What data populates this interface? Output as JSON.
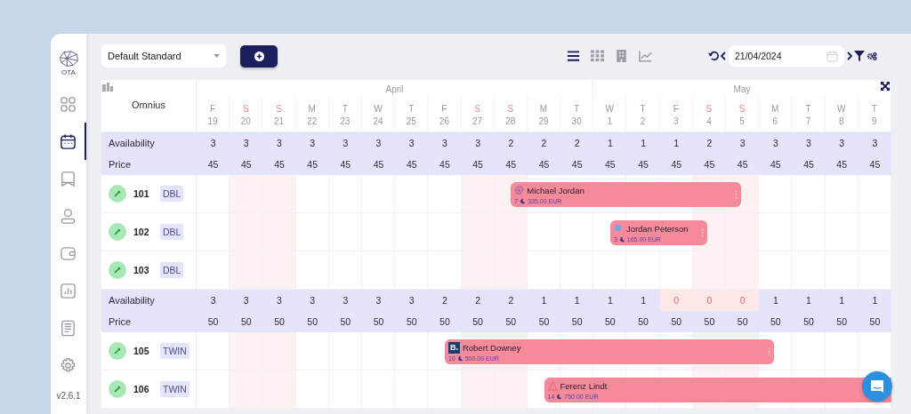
{
  "sidebar": {
    "logo_text": "OTA",
    "items": [
      {
        "kind": "dashboard",
        "selected": false
      },
      {
        "kind": "calendar",
        "selected": true
      },
      {
        "kind": "bookmark",
        "selected": false
      },
      {
        "kind": "user",
        "selected": false
      },
      {
        "kind": "wallet",
        "selected": false
      },
      {
        "kind": "chart",
        "selected": false
      },
      {
        "kind": "document",
        "selected": false
      },
      {
        "kind": "settings",
        "selected": false
      }
    ],
    "version": "v2.6.1"
  },
  "toolbar": {
    "rate_plan": "Default Standard",
    "views": [
      {
        "kind": "list",
        "selected": true
      },
      {
        "kind": "grid",
        "selected": false
      },
      {
        "kind": "building",
        "selected": false
      },
      {
        "kind": "chart",
        "selected": false
      }
    ],
    "date": "21/04/2024"
  },
  "calendar": {
    "property": "Omnius",
    "months": [
      {
        "label": "April",
        "days": [
          {
            "weekday": "F",
            "date": "19",
            "weekend": false
          },
          {
            "weekday": "S",
            "date": "20",
            "weekend": true
          },
          {
            "weekday": "S",
            "date": "21",
            "weekend": true
          },
          {
            "weekday": "M",
            "date": "22",
            "weekend": false
          },
          {
            "weekday": "T",
            "date": "23",
            "weekend": false
          },
          {
            "weekday": "W",
            "date": "24",
            "weekend": false
          },
          {
            "weekday": "T",
            "date": "25",
            "weekend": false
          },
          {
            "weekday": "F",
            "date": "26",
            "weekend": false
          },
          {
            "weekday": "S",
            "date": "27",
            "weekend": true
          },
          {
            "weekday": "S",
            "date": "28",
            "weekend": true
          },
          {
            "weekday": "M",
            "date": "29",
            "weekend": false
          },
          {
            "weekday": "T",
            "date": "30",
            "weekend": false
          }
        ]
      },
      {
        "label": "May",
        "days": [
          {
            "weekday": "W",
            "date": "1",
            "weekend": false
          },
          {
            "weekday": "T",
            "date": "2",
            "weekend": false
          },
          {
            "weekday": "F",
            "date": "3",
            "weekend": false
          },
          {
            "weekday": "S",
            "date": "4",
            "weekend": true
          },
          {
            "weekday": "S",
            "date": "5",
            "weekend": true
          },
          {
            "weekday": "M",
            "date": "6",
            "weekend": false
          },
          {
            "weekday": "T",
            "date": "7",
            "weekend": false
          },
          {
            "weekday": "W",
            "date": "8",
            "weekend": false
          },
          {
            "weekday": "T",
            "date": "9",
            "weekend": false
          }
        ]
      }
    ],
    "groups": [
      {
        "availability_label": "Availability",
        "price_label": "Price",
        "availability": [
          {
            "value": "3",
            "sold_out": false
          },
          {
            "value": "3",
            "sold_out": false
          },
          {
            "value": "3",
            "sold_out": false
          },
          {
            "value": "3",
            "sold_out": false
          },
          {
            "value": "3",
            "sold_out": false
          },
          {
            "value": "3",
            "sold_out": false
          },
          {
            "value": "3",
            "sold_out": false
          },
          {
            "value": "3",
            "sold_out": false
          },
          {
            "value": "3",
            "sold_out": false
          },
          {
            "value": "2",
            "sold_out": false
          },
          {
            "value": "2",
            "sold_out": false
          },
          {
            "value": "2",
            "sold_out": false
          },
          {
            "value": "1",
            "sold_out": false
          },
          {
            "value": "1",
            "sold_out": false
          },
          {
            "value": "1",
            "sold_out": false
          },
          {
            "value": "2",
            "sold_out": false
          },
          {
            "value": "3",
            "sold_out": false
          },
          {
            "value": "3",
            "sold_out": false
          },
          {
            "value": "3",
            "sold_out": false
          },
          {
            "value": "3",
            "sold_out": false
          },
          {
            "value": "3",
            "sold_out": false
          }
        ],
        "price": [
          "45",
          "45",
          "45",
          "45",
          "45",
          "45",
          "45",
          "45",
          "45",
          "45",
          "45",
          "45",
          "45",
          "45",
          "45",
          "45",
          "45",
          "45",
          "45",
          "45",
          "45"
        ],
        "rooms": [
          {
            "number": "101",
            "type": "DBL",
            "clean": true,
            "slots": [
              {
                "kind": "free"
              },
              {
                "kind": "free"
              },
              {
                "kind": "free"
              },
              {
                "kind": "free"
              },
              {
                "kind": "free"
              },
              {
                "kind": "free"
              },
              {
                "kind": "free"
              },
              {
                "kind": "free"
              },
              {
                "kind": "free"
              },
              {
                "kind": "booking",
                "guest": "Michael Jordan",
                "nights": "7",
                "amount": "335.00 EUR",
                "source": {
                  "kind": "mesh"
                }
              }
            ]
          },
          {
            "number": "102",
            "type": "DBL",
            "clean": true,
            "slots": [
              {
                "kind": "free"
              },
              {
                "kind": "free"
              },
              {
                "kind": "free"
              },
              {
                "kind": "free"
              },
              {
                "kind": "free"
              },
              {
                "kind": "free"
              },
              {
                "kind": "free"
              },
              {
                "kind": "free"
              },
              {
                "kind": "free"
              },
              {
                "kind": "free"
              },
              {
                "kind": "free"
              },
              {
                "kind": "free"
              },
              {
                "kind": "booking",
                "guest": "Jordan Peterson",
                "nights": "3",
                "amount": "165.00 EUR",
                "source": {
                  "kind": "dot"
                }
              }
            ]
          },
          {
            "number": "103",
            "type": "DBL",
            "clean": true
          }
        ]
      },
      {
        "availability_label": "Availability",
        "price_label": "Price",
        "availability": [
          {
            "value": "3",
            "sold_out": false
          },
          {
            "value": "3",
            "sold_out": false
          },
          {
            "value": "3",
            "sold_out": false
          },
          {
            "value": "3",
            "sold_out": false
          },
          {
            "value": "3",
            "sold_out": false
          },
          {
            "value": "3",
            "sold_out": false
          },
          {
            "value": "3",
            "sold_out": false
          },
          {
            "value": "2",
            "sold_out": false
          },
          {
            "value": "2",
            "sold_out": false
          },
          {
            "value": "2",
            "sold_out": false
          },
          {
            "value": "1",
            "sold_out": false
          },
          {
            "value": "1",
            "sold_out": false
          },
          {
            "value": "1",
            "sold_out": false
          },
          {
            "value": "1",
            "sold_out": false
          },
          {
            "value": "0",
            "sold_out": true
          },
          {
            "value": "0",
            "sold_out": true
          },
          {
            "value": "0",
            "sold_out": true
          },
          {
            "value": "1",
            "sold_out": false
          },
          {
            "value": "1",
            "sold_out": false
          },
          {
            "value": "1",
            "sold_out": false
          },
          {
            "value": "1",
            "sold_out": false
          }
        ],
        "price": [
          "50",
          "50",
          "50",
          "50",
          "50",
          "50",
          "50",
          "50",
          "50",
          "50",
          "50",
          "50",
          "50",
          "50",
          "50",
          "50",
          "50",
          "50",
          "50",
          "50",
          "50"
        ],
        "rooms": [
          {
            "number": "105",
            "type": "TWIN",
            "clean": true,
            "slots": [
              {
                "kind": "free"
              },
              {
                "kind": "free"
              },
              {
                "kind": "free"
              },
              {
                "kind": "free"
              },
              {
                "kind": "free"
              },
              {
                "kind": "free"
              },
              {
                "kind": "free"
              },
              {
                "kind": "booking",
                "guest": "Robert Downey",
                "nights": "10",
                "amount": "500.00 EUR",
                "source": {
                  "kind": "letter",
                  "label": "B."
                }
              }
            ]
          },
          {
            "number": "106",
            "type": "TWIN",
            "clean": true,
            "slots": [
              {
                "kind": "free"
              },
              {
                "kind": "free"
              },
              {
                "kind": "free"
              },
              {
                "kind": "free"
              },
              {
                "kind": "free"
              },
              {
                "kind": "free"
              },
              {
                "kind": "free"
              },
              {
                "kind": "free"
              },
              {
                "kind": "free"
              },
              {
                "kind": "free"
              },
              {
                "kind": "booking",
                "guest": "Ferenz Lindt",
                "nights": "14",
                "amount": "750.00 EUR",
                "source": {
                  "kind": "triangle"
                }
              }
            ]
          }
        ]
      }
    ]
  }
}
